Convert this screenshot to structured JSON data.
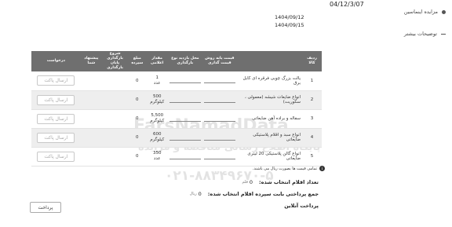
{
  "header": {
    "title": "مزایده اینماسین",
    "number": "04/12/3/07"
  },
  "dates": [
    "1404/09/12",
    "1404/09/15"
  ],
  "section": {
    "title": "توضیحات بیشتر"
  },
  "watermark": {
    "line1": "FarsNamadData",
    "line2": "پایگاه اطلاع رسانی مناقصه و مزایده",
    "line3": "۰۲۱-۸۸۳۴۹۶۷۰-۵"
  },
  "table": {
    "headers": [
      "ردیف کالا",
      "",
      "قیمت پایه روش قیمت گذاری",
      "محل بازدید نوع بارگذاری",
      "مقدار اعلامی",
      "مبلغ سپرده",
      "شروع بارگذاری پایان بارگذاری",
      "پیشنهاد شما",
      "درخواست"
    ],
    "rows": [
      {
        "idx": "1",
        "name": "یالت بزرگ چوبی فرقره ای کابل برق",
        "qty": "1",
        "unit": "عدد",
        "deposit": "0",
        "button": "ارسال پاکت"
      },
      {
        "idx": "2",
        "name": "انواع ضایعات شیشه (معمولی ، سکوریت)",
        "qty": "500",
        "unit": "کیلوگرم",
        "deposit": "0",
        "button": "ارسال پاکت"
      },
      {
        "idx": "3",
        "name": "سفاله و براده آهن ضایعاتی",
        "qty": "5,500",
        "unit": "کیلوگرم",
        "deposit": "0",
        "button": "ارسال پاکت"
      },
      {
        "idx": "4",
        "name": "انواع سبد و اقلام پلاستیکی ضایعاتی",
        "qty": "600",
        "unit": "کیلوگرم",
        "deposit": "0",
        "button": "ارسال پاکت"
      },
      {
        "idx": "5",
        "name": "انواع گالن پلاستیکی 20 لیتری ضایعاتی",
        "qty": "350",
        "unit": "عدد",
        "deposit": "0",
        "button": "ارسال پاکت"
      }
    ]
  },
  "note": "تمامی قیمت ها بصورت ریال می باشند.",
  "summary": {
    "count_label": "تعداد اقلام انتخاب شده:",
    "count_value": "0",
    "count_unit": "قلم",
    "total_label": "جمع پرداختی بابت سپرده اقلام انتخاب شده:",
    "total_value": "0",
    "total_unit": "ریال",
    "online_label": "پرداخت آنلاین"
  },
  "pay_button": "پرداخت"
}
